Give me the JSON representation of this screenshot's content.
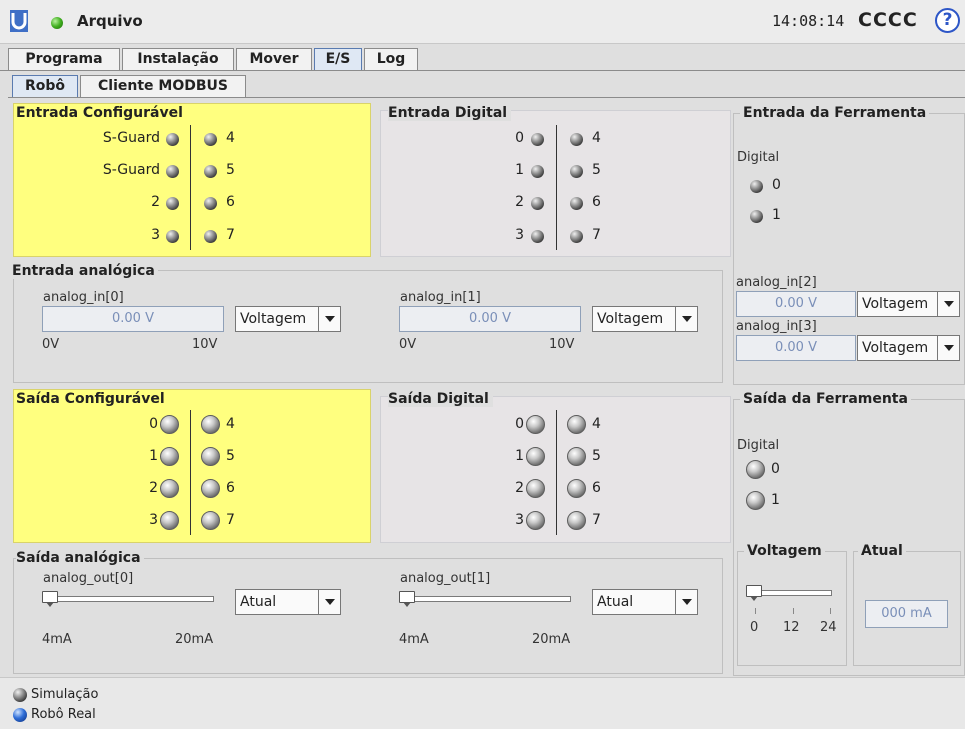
{
  "header": {
    "app_title": "Arquivo",
    "time": "14:08:14",
    "robot_name": "CCCC",
    "help": "?"
  },
  "tabs": [
    {
      "label": "Programa"
    },
    {
      "label": "Instalação"
    },
    {
      "label": "Mover"
    },
    {
      "label": "E/S",
      "active": true
    },
    {
      "label": "Log"
    }
  ],
  "subtabs": [
    {
      "label": "Robô",
      "active": true
    },
    {
      "label": "Cliente MODBUS"
    }
  ],
  "config_input": {
    "title": "Entrada Configurável",
    "left": [
      "S-Guard",
      "S-Guard",
      "2",
      "3"
    ],
    "right": [
      "4",
      "5",
      "6",
      "7"
    ]
  },
  "digital_input": {
    "title": "Entrada Digital",
    "left": [
      "0",
      "1",
      "2",
      "3"
    ],
    "right": [
      "4",
      "5",
      "6",
      "7"
    ]
  },
  "tool_input": {
    "title": "Entrada da Ferramenta",
    "digital_label": "Digital",
    "items": [
      "0",
      "1"
    ],
    "analog": [
      {
        "label": "analog_in[2]",
        "value": "0.00 V",
        "mode": "Voltagem"
      },
      {
        "label": "analog_in[3]",
        "value": "0.00 V",
        "mode": "Voltagem"
      }
    ]
  },
  "analog_input": {
    "title": "Entrada analógica",
    "channels": [
      {
        "label": "analog_in[0]",
        "value": "0.00 V",
        "mode": "Voltagem",
        "min": "0V",
        "max": "10V"
      },
      {
        "label": "analog_in[1]",
        "value": "0.00 V",
        "mode": "Voltagem",
        "min": "0V",
        "max": "10V"
      }
    ]
  },
  "config_output": {
    "title": "Saída Configurável",
    "left": [
      "0",
      "1",
      "2",
      "3"
    ],
    "right": [
      "4",
      "5",
      "6",
      "7"
    ]
  },
  "digital_output": {
    "title": "Saída Digital",
    "left": [
      "0",
      "1",
      "2",
      "3"
    ],
    "right": [
      "4",
      "5",
      "6",
      "7"
    ]
  },
  "tool_output": {
    "title": "Saída da Ferramenta",
    "digital_label": "Digital",
    "items": [
      "0",
      "1"
    ],
    "voltage_title": "Voltagem",
    "ticks": [
      "0",
      "12",
      "24"
    ],
    "current_title": "Atual",
    "current_value": "000 mA"
  },
  "analog_output": {
    "title": "Saída analógica",
    "channels": [
      {
        "label": "analog_out[0]",
        "mode": "Atual",
        "min": "4mA",
        "max": "20mA",
        "level": 0
      },
      {
        "label": "analog_out[1]",
        "mode": "Atual",
        "min": "4mA",
        "max": "20mA",
        "level": 0
      }
    ]
  },
  "footer": {
    "simulation": "Simulação",
    "real": "Robô Real"
  }
}
